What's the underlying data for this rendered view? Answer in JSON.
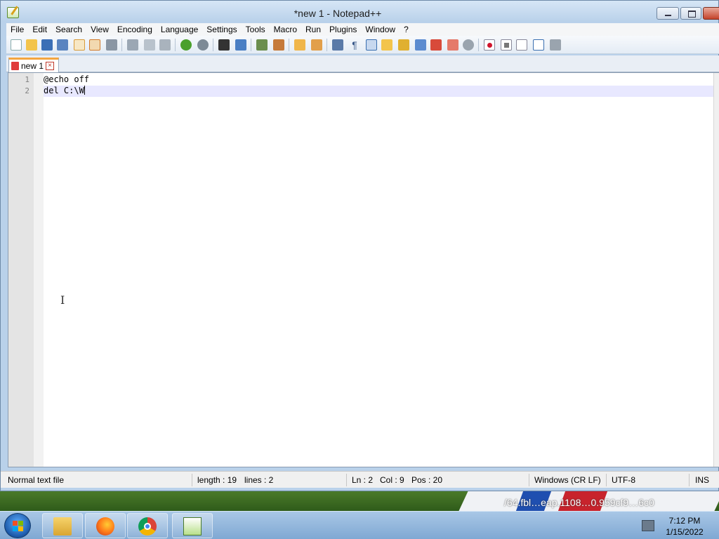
{
  "window": {
    "title": "*new 1 - Notepad++"
  },
  "menu": [
    "File",
    "Edit",
    "Search",
    "View",
    "Encoding",
    "Language",
    "Settings",
    "Tools",
    "Macro",
    "Run",
    "Plugins",
    "Window",
    "?"
  ],
  "toolbar": {
    "icons": [
      "new-file-icon",
      "open-file-icon",
      "save-icon",
      "save-all-icon",
      "close-icon",
      "close-all-icon",
      "print-icon",
      "cut-icon",
      "copy-icon",
      "paste-icon",
      "undo-icon",
      "redo-icon",
      "find-icon",
      "replace-icon",
      "zoom-in-icon",
      "zoom-out-icon",
      "sync-vertical-icon",
      "sync-horizontal-icon",
      "word-wrap-icon",
      "show-all-chars-icon",
      "indent-guide-icon",
      "user-defined-language-icon",
      "document-map-icon",
      "function-list-icon",
      "folder-as-workspace-icon",
      "monitoring-icon",
      "start-recording-icon",
      "stop-recording-icon",
      "playback-icon",
      "run-macro-multiple-icon",
      "save-macro-icon"
    ]
  },
  "tabs": [
    {
      "label": "new 1",
      "modified": true
    }
  ],
  "editor": {
    "lines": [
      {
        "number": "1",
        "text": "@echo off"
      },
      {
        "number": "2",
        "text": "del C:\\W"
      }
    ],
    "current_line": 2
  },
  "status": {
    "file_type": "Normal text file",
    "length": "length : 19",
    "lines": "lines : 2",
    "ln": "Ln : 2",
    "col": "Col : 9",
    "pos": "Pos : 20",
    "eol": "Windows (CR LF)",
    "encoding": "UTF-8",
    "mode": "INS"
  },
  "desktop": {
    "wallpaper_text": "/64.fbl…eap.1108…0.959cf9…6c0"
  },
  "taskbar": {
    "apps": [
      "file-explorer",
      "firefox",
      "chrome",
      "notepad++"
    ],
    "time": "7:12 PM",
    "date": "1/15/2022"
  },
  "colors": {
    "current_line": "#e8e8ff",
    "tab_accent": "#f4a640",
    "close_button": "#c4422a"
  }
}
